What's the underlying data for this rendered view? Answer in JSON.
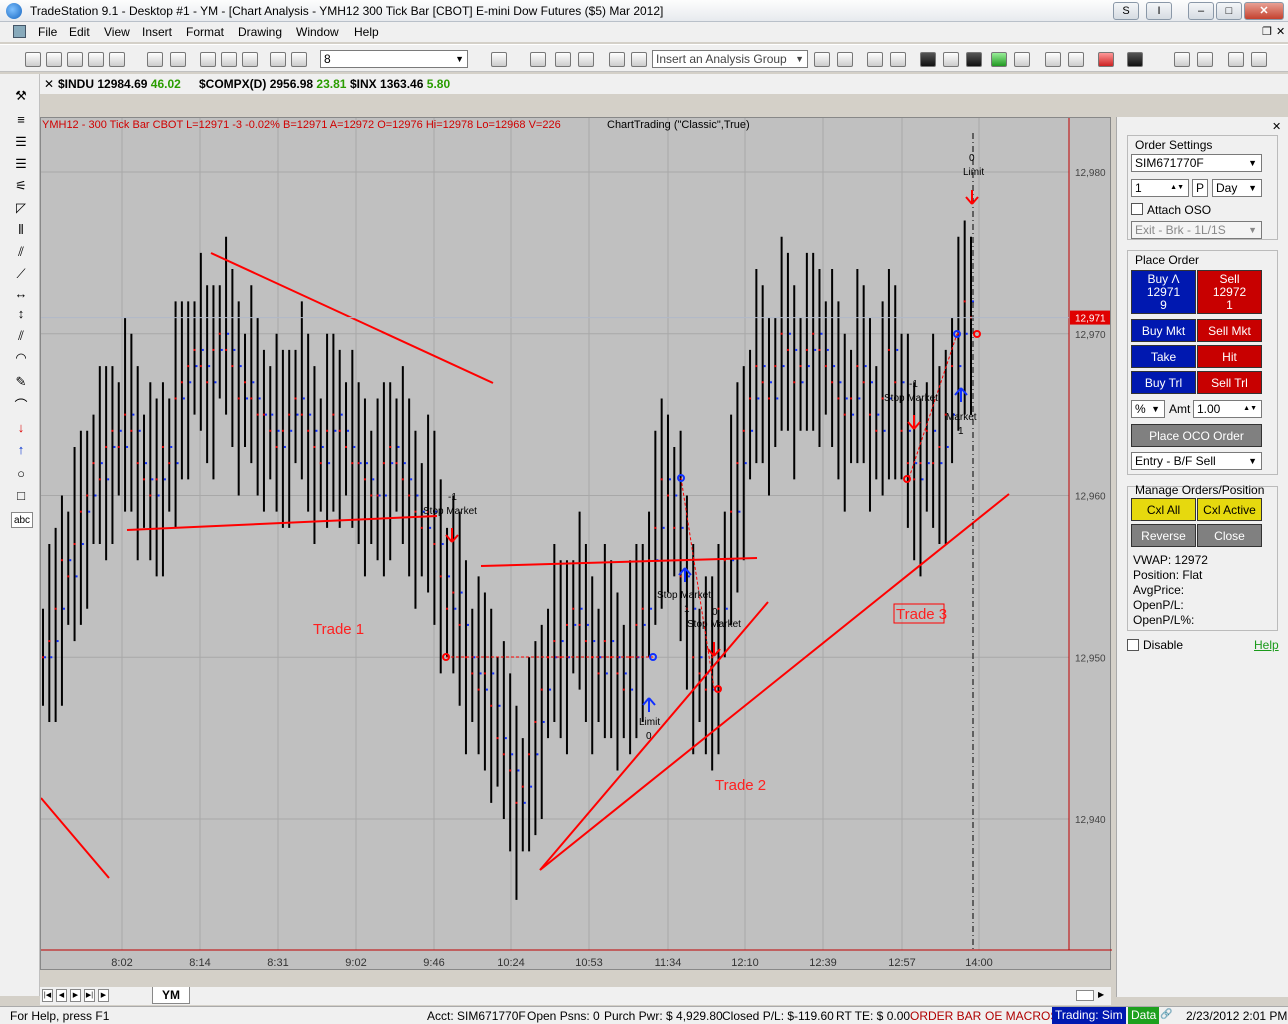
{
  "window": {
    "title": "TradeStation 9.1 - Desktop #1 - YM - [Chart Analysis - YMH12 300 Tick Bar [CBOT] E-mini Dow Futures ($5) Mar 2012]",
    "btn_s": "S",
    "btn_i": "I",
    "btn_min": "–",
    "btn_max": "□",
    "btn_close": "✕"
  },
  "menu": [
    "File",
    "Edit",
    "View",
    "Insert",
    "Format",
    "Drawing",
    "Window",
    "Help"
  ],
  "toolbar": {
    "interval_value": "8",
    "analysis_group_placeholder": "Insert an Analysis Group"
  },
  "symbols": [
    {
      "name": "$INDU",
      "price": "12984.69",
      "change": "46.02"
    },
    {
      "name": "$COMPX(D)",
      "price": "2956.98",
      "change": "23.81"
    },
    {
      "name": "$INX",
      "price": "1363.46",
      "change": "5.80"
    }
  ],
  "chart_header": {
    "symbol": "YMH12 - 300 Tick Bar  CBOT  L=12971  -3  -0.02%  B=12971  A=12972  O=12976  Hi=12978  Lo=12968  V=226",
    "strategy": "ChartTrading (\"Classic\",True)"
  },
  "chart_data": {
    "type": "bar",
    "price_axis": {
      "ticks": [
        "12,980",
        "12,970",
        "12,960",
        "12,950",
        "12,940"
      ],
      "tick_values": [
        12980,
        12970,
        12960,
        12950,
        12940
      ],
      "last_price_label": "12,971",
      "last_price": 12971
    },
    "time_axis": {
      "ticks": [
        "8:02",
        "8:14",
        "8:31",
        "9:02",
        "9:46",
        "10:24",
        "10:53",
        "11:34",
        "12:10",
        "12:39",
        "12:57",
        "14:00"
      ]
    },
    "annotations": [
      {
        "text": "Trade 1",
        "color": "#ff2020"
      },
      {
        "text": "Trade 2",
        "color": "#ff2020"
      },
      {
        "text": "Trade 3",
        "color": "#ff2020"
      },
      {
        "text": "-1",
        "color": "#000000"
      },
      {
        "text": "Stop Market",
        "color": "#000000"
      },
      {
        "text": "1",
        "color": "#000000"
      },
      {
        "text": "Stop Market",
        "color": "#000000"
      },
      {
        "text": "0",
        "color": "#000000"
      },
      {
        "text": "Stop Market",
        "color": "#000000"
      },
      {
        "text": "Limit",
        "color": "#000000"
      },
      {
        "text": "0",
        "color": "#000000"
      },
      {
        "text": "-1",
        "color": "#000000"
      },
      {
        "text": "Stop Market",
        "color": "#000000"
      },
      {
        "text": "Market",
        "color": "#000000"
      },
      {
        "text": "1",
        "color": "#000000"
      },
      {
        "text": "0",
        "color": "#000000"
      },
      {
        "text": "Limit",
        "color": "#000000"
      }
    ],
    "series_close": [
      12950,
      12951,
      12953,
      12956,
      12955,
      12957,
      12959,
      12960,
      12962,
      12961,
      12963,
      12964,
      12963,
      12965,
      12964,
      12962,
      12961,
      12960,
      12961,
      12963,
      12962,
      12966,
      12967,
      12968,
      12969,
      12968,
      12967,
      12969,
      12970,
      12969,
      12968,
      12966,
      12967,
      12966,
      12965,
      12965,
      12964,
      12963,
      12964,
      12965,
      12966,
      12965,
      12964,
      12963,
      12962,
      12964,
      12965,
      12964,
      12963,
      12962,
      12962,
      12961,
      12960,
      12960,
      12962,
      12963,
      12962,
      12961,
      12960,
      12959,
      12958,
      12959,
      12957,
      12955,
      12953,
      12954,
      12952,
      12950,
      12949,
      12948,
      12949,
      12947,
      12945,
      12944,
      12943,
      12941,
      12942,
      12944,
      12946,
      12948,
      12950,
      12951,
      12950,
      12952,
      12953,
      12952,
      12951,
      12950,
      12949,
      12951,
      12950,
      12949,
      12948,
      12950,
      12952,
      12953,
      12956,
      12958,
      12961,
      12960,
      12958,
      12955,
      12953,
      12950,
      12949,
      12948,
      12950,
      12953,
      12956,
      12959,
      12962,
      12964,
      12966,
      12968,
      12967,
      12966,
      12968,
      12970,
      12969,
      12967,
      12968,
      12969,
      12970,
      12969,
      12968,
      12967,
      12966,
      12965,
      12966,
      12968,
      12967,
      12965,
      12964,
      12966,
      12969,
      12967,
      12964,
      12962,
      12961,
      12962,
      12964,
      12962,
      12963,
      12965,
      12968,
      12970,
      12972,
      12971
    ]
  },
  "order_settings": {
    "title": "Order Settings",
    "account": "SIM671770F",
    "qty": "1",
    "p_label": "P",
    "duration": "Day",
    "attach_oso": "Attach OSO",
    "exit_strategy": "Exit - Brk - 1L/1S"
  },
  "place_order": {
    "title": "Place Order",
    "buy_label": "Buy Λ",
    "buy_price": "12971",
    "buy_size": "9",
    "sell_label": "Sell",
    "sell_price": "12972",
    "sell_size": "1",
    "buy_mkt": "Buy Mkt",
    "sell_mkt": "Sell Mkt",
    "take": "Take",
    "hit": "Hit",
    "buy_trl": "Buy Trl",
    "sell_trl": "Sell Trl",
    "pct": "%",
    "amt_label": "Amt",
    "amt_value": "1.00",
    "oco": "Place OCO Order",
    "entry_strategy": "Entry - B/F Sell"
  },
  "manage": {
    "title": "Manage Orders/Position",
    "cxl_all": "Cxl All",
    "cxl_active": "Cxl Active",
    "reverse": "Reverse",
    "close": "Close",
    "vwap": "VWAP: 12972",
    "position": "Position: Flat",
    "avg_price": "AvgPrice:",
    "open_pl": "OpenP/L:",
    "open_pl_pct": "OpenP/L%:",
    "disable": "Disable",
    "help": "Help"
  },
  "bottom_tab": "YM",
  "status": {
    "help": "For Help, press F1",
    "acct": "Acct: SIM671770F",
    "open_psns": "Open Psns: 0",
    "purch_pwr": "Purch Pwr: $ 4,929.80",
    "closed_pl": "Closed P/L: $-119.60",
    "rt_te": "RT TE: $ 0.00",
    "order_bar": "ORDER BAR",
    "oe_macros": "OE MACROS",
    "trading": "Trading: Sim",
    "data": "Data",
    "datetime": "2/23/2012 2:01 PM"
  },
  "colors": {
    "chart_bg": "#c0c0c0",
    "line_red": "#ff0000",
    "buy_blue": "#0018b0",
    "sell_red": "#c80000"
  }
}
